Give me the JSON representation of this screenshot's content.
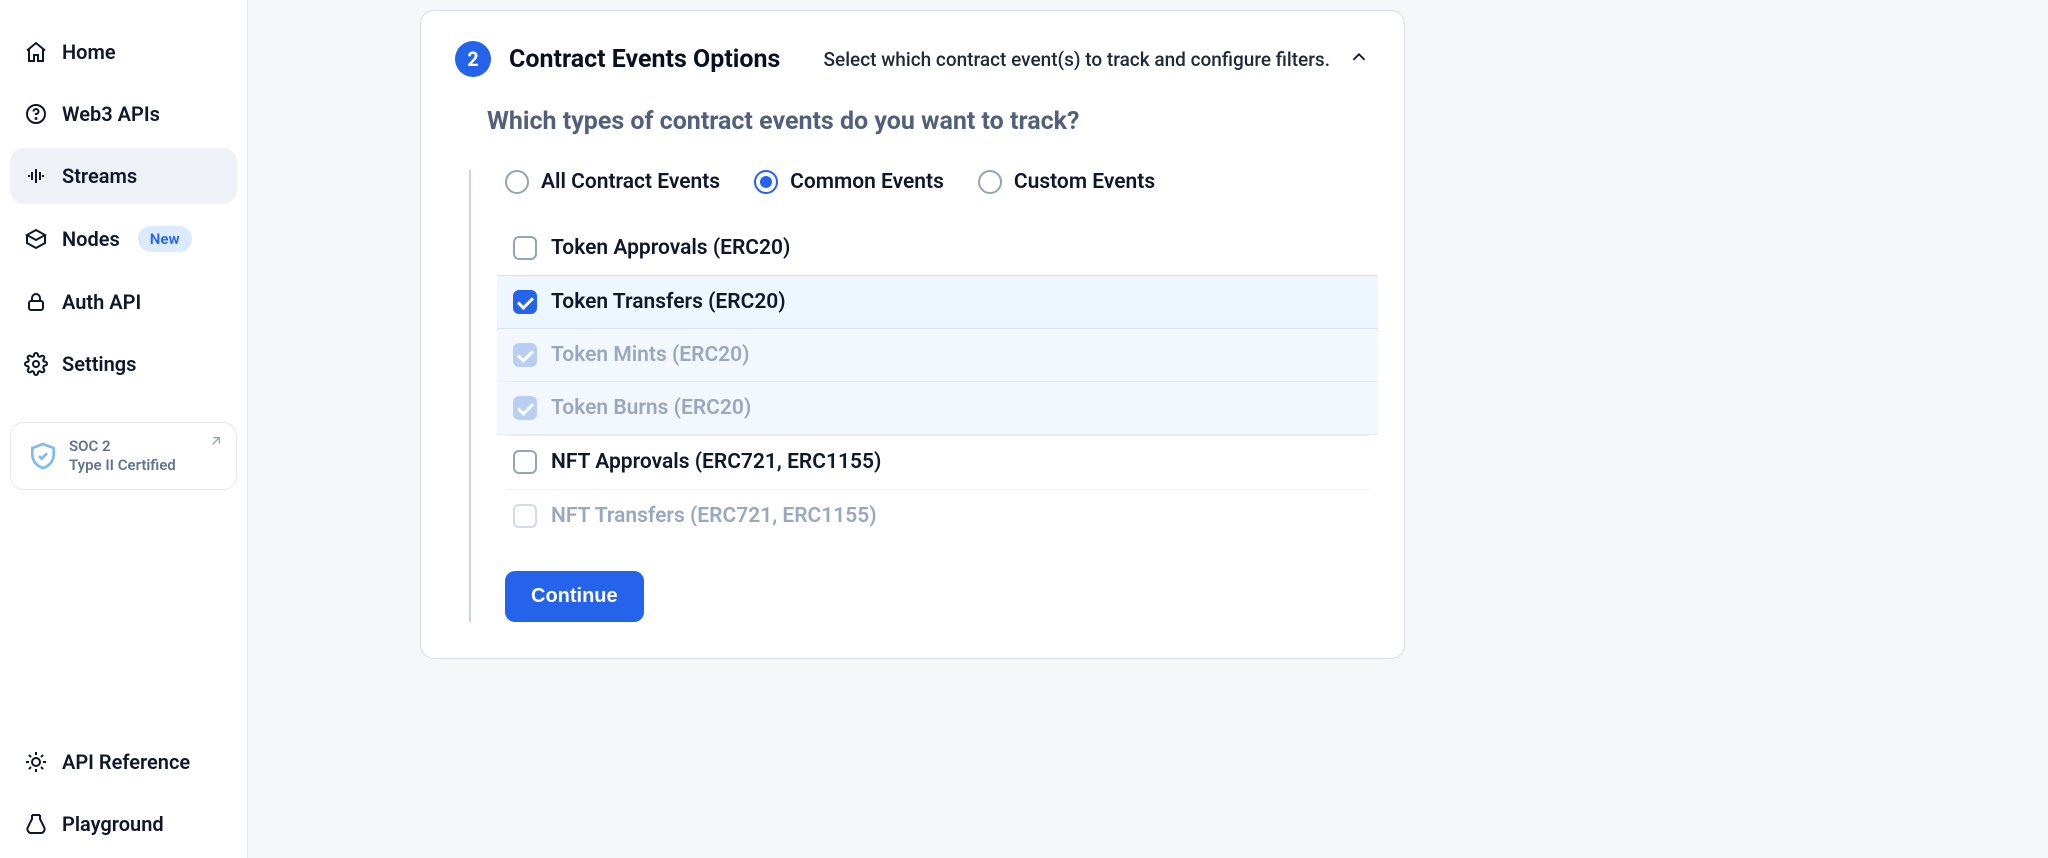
{
  "sidebar": {
    "items": [
      {
        "label": "Home"
      },
      {
        "label": "Web3 APIs"
      },
      {
        "label": "Streams"
      },
      {
        "label": "Nodes",
        "badge": "New"
      },
      {
        "label": "Auth API"
      },
      {
        "label": "Settings"
      }
    ],
    "soc": {
      "line1": "SOC 2",
      "line2": "Type II Certified"
    },
    "bottom": [
      {
        "label": "API Reference"
      },
      {
        "label": "Playground"
      }
    ]
  },
  "card": {
    "step": "2",
    "title": "Contract Events Options",
    "subtitle": "Select which contract event(s) to track and configure filters.",
    "question": "Which types of contract events do you want to track?",
    "radios": [
      {
        "label": "All Contract Events",
        "selected": false
      },
      {
        "label": "Common Events",
        "selected": true
      },
      {
        "label": "Custom Events",
        "selected": false
      }
    ],
    "checks": [
      {
        "label": "Token Approvals (ERC20)",
        "state": "unchecked"
      },
      {
        "label": "Token Transfers (ERC20)",
        "state": "checked"
      },
      {
        "label": "Token Mints (ERC20)",
        "state": "dim"
      },
      {
        "label": "Token Burns (ERC20)",
        "state": "dim"
      },
      {
        "label": "NFT Approvals (ERC721, ERC1155)",
        "state": "unchecked"
      },
      {
        "label": "NFT Transfers (ERC721, ERC1155)",
        "state": "disabled"
      }
    ],
    "continue": "Continue"
  }
}
